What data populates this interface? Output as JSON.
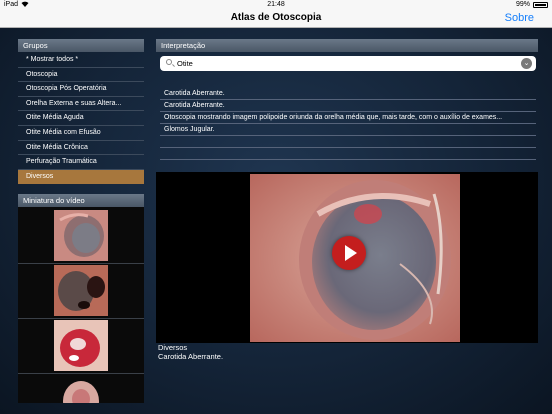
{
  "status_bar": {
    "carrier": "iPad",
    "time": "21:48",
    "battery": "99%"
  },
  "nav": {
    "title": "Atlas de Otoscopia",
    "about_label": "Sobre"
  },
  "groups": {
    "header": "Grupos",
    "items": [
      "* Mostrar todos *",
      "Otoscopia",
      "Otoscopia Pós Operatória",
      "Orelha Externa e suas Altera...",
      "Otite Média Aguda",
      "Otite Média com Efusão",
      "Otite Média Crônica",
      "Perfuração Traumática",
      "Diversos"
    ],
    "selected": "Diversos"
  },
  "thumbnails": {
    "header": "Miniatura do vídeo",
    "count_visible": 4
  },
  "interpretation": {
    "header": "Interpretação",
    "search_value": "Otite",
    "results": [
      "Carotida Aberrante.",
      "Carotida Aberrante.",
      "Otoscopia mostrando imagem polipoide oriunda da orelha média que, mais tarde, com o auxílio de exames...",
      "Glomos Jugular."
    ]
  },
  "video": {
    "category": "Diversos",
    "caption": "Carotida Aberrante."
  },
  "colors": {
    "selected_group": "#a7773d",
    "nav_link": "#147efb",
    "play_button": "#c41e1e"
  },
  "icons": [
    "wifi-icon",
    "battery-icon",
    "search-icon",
    "chevron-down-icon",
    "play-icon"
  ]
}
